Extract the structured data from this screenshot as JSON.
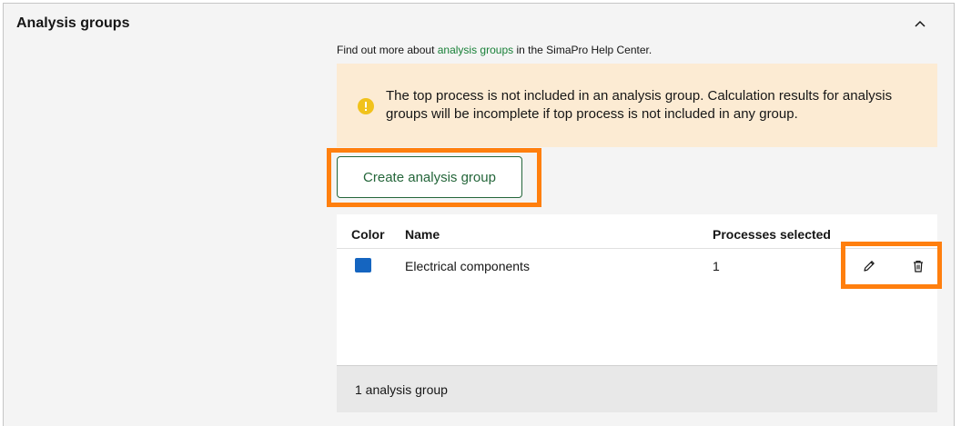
{
  "section": {
    "title": "Analysis groups",
    "collapse_icon": "chevron-up-icon"
  },
  "help": {
    "prefix": "Find out more about ",
    "link": "analysis groups",
    "suffix": " in the SimaPro Help Center."
  },
  "warning": {
    "icon": "warning-circle-icon",
    "text": "The top process is not included in an analysis group. Calculation results for analysis groups will be incomplete if top process is not included in any group.",
    "icon_color": "#f1c21b",
    "background": "#fcebd3"
  },
  "create_button": {
    "label": "Create analysis group"
  },
  "table": {
    "columns": [
      "Color",
      "Name",
      "Processes selected"
    ],
    "rows": [
      {
        "color": "#1565c0",
        "name": "Electrical components",
        "processes_selected": "1",
        "actions": [
          "edit-pencil-icon",
          "delete-trash-icon"
        ]
      }
    ],
    "footer": "1 analysis group"
  },
  "highlight_color": "#ff7f0e"
}
